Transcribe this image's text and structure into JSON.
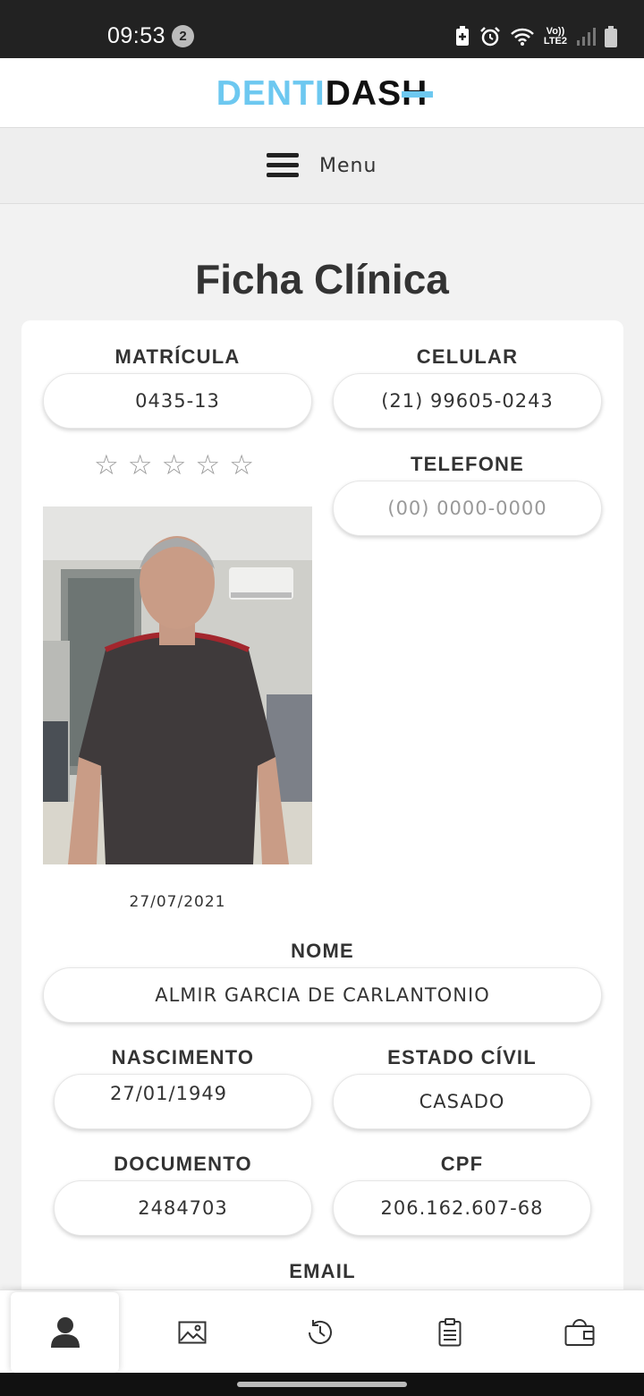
{
  "status_bar": {
    "time": "09:53",
    "notification_count": "2",
    "network_label_top": "Vo))",
    "network_label_bottom": "LTE2"
  },
  "brand": {
    "logo_part1": "DENTI",
    "logo_part2": "DAS",
    "logo_part3": "H",
    "accent_color": "#6dc8f0"
  },
  "menu": {
    "label": "Menu"
  },
  "page": {
    "title": "Ficha Clínica"
  },
  "record": {
    "matricula_label": "MATRÍCULA",
    "matricula_value": "0435-13",
    "celular_label": "CELULAR",
    "celular_value": "(21) 99605-0243",
    "telefone_label": "TELEFONE",
    "telefone_placeholder": "(00) 0000-0000",
    "rating": 0,
    "rating_max": 5,
    "photo_date": "27/07/2021",
    "nome_label": "NOME",
    "nome_value": "ALMIR GARCIA DE CARLANTONIO",
    "nascimento_label": "NASCIMENTO",
    "nascimento_value": "27/01/1949",
    "estado_civil_label": "ESTADO CÍVIL",
    "estado_civil_value": "CASADO",
    "documento_label": "DOCUMENTO",
    "documento_value": "2484703",
    "cpf_label": "CPF",
    "cpf_value": "206.162.607-68",
    "email_label": "EMAIL"
  },
  "tabs": [
    {
      "icon": "user-icon",
      "active": true
    },
    {
      "icon": "image-icon",
      "active": false
    },
    {
      "icon": "history-icon",
      "active": false
    },
    {
      "icon": "clipboard-icon",
      "active": false
    },
    {
      "icon": "wallet-icon",
      "active": false
    }
  ]
}
